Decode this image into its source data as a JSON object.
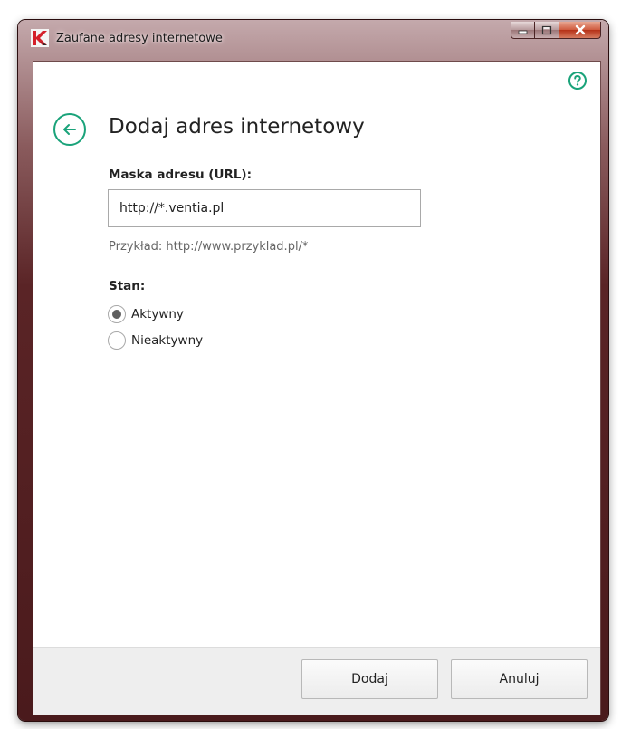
{
  "window": {
    "title": "Zaufane adresy internetowe",
    "app_icon": "kaspersky-logo",
    "caption_buttons": [
      "minimize-icon",
      "maximize-icon",
      "close-icon"
    ]
  },
  "header": {
    "title": "Dodaj adres internetowy",
    "back_icon": "back-arrow-icon",
    "help_icon": "help-icon"
  },
  "form": {
    "url_label": "Maska adresu (URL):",
    "url_value": "http://*.ventia.pl",
    "hint": "Przykład: http://www.przyklad.pl/*",
    "state_label": "Stan:",
    "state_options": [
      {
        "label": "Aktywny",
        "selected": true
      },
      {
        "label": "Nieaktywny",
        "selected": false
      }
    ]
  },
  "footer": {
    "add_label": "Dodaj",
    "cancel_label": "Anuluj"
  },
  "colors": {
    "accent": "#1aa37a",
    "frame": "#5a2426"
  }
}
